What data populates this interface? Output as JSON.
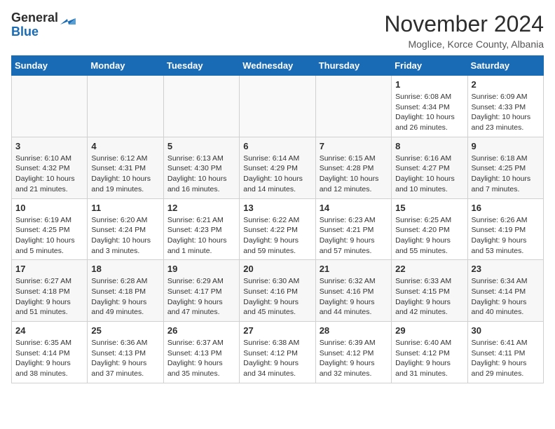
{
  "header": {
    "logo_line1": "General",
    "logo_line2": "Blue",
    "title": "November 2024",
    "subtitle": "Moglice, Korce County, Albania"
  },
  "columns": [
    "Sunday",
    "Monday",
    "Tuesday",
    "Wednesday",
    "Thursday",
    "Friday",
    "Saturday"
  ],
  "weeks": [
    [
      {
        "day": "",
        "info": ""
      },
      {
        "day": "",
        "info": ""
      },
      {
        "day": "",
        "info": ""
      },
      {
        "day": "",
        "info": ""
      },
      {
        "day": "",
        "info": ""
      },
      {
        "day": "1",
        "info": "Sunrise: 6:08 AM\nSunset: 4:34 PM\nDaylight: 10 hours and 26 minutes."
      },
      {
        "day": "2",
        "info": "Sunrise: 6:09 AM\nSunset: 4:33 PM\nDaylight: 10 hours and 23 minutes."
      }
    ],
    [
      {
        "day": "3",
        "info": "Sunrise: 6:10 AM\nSunset: 4:32 PM\nDaylight: 10 hours and 21 minutes."
      },
      {
        "day": "4",
        "info": "Sunrise: 6:12 AM\nSunset: 4:31 PM\nDaylight: 10 hours and 19 minutes."
      },
      {
        "day": "5",
        "info": "Sunrise: 6:13 AM\nSunset: 4:30 PM\nDaylight: 10 hours and 16 minutes."
      },
      {
        "day": "6",
        "info": "Sunrise: 6:14 AM\nSunset: 4:29 PM\nDaylight: 10 hours and 14 minutes."
      },
      {
        "day": "7",
        "info": "Sunrise: 6:15 AM\nSunset: 4:28 PM\nDaylight: 10 hours and 12 minutes."
      },
      {
        "day": "8",
        "info": "Sunrise: 6:16 AM\nSunset: 4:27 PM\nDaylight: 10 hours and 10 minutes."
      },
      {
        "day": "9",
        "info": "Sunrise: 6:18 AM\nSunset: 4:25 PM\nDaylight: 10 hours and 7 minutes."
      }
    ],
    [
      {
        "day": "10",
        "info": "Sunrise: 6:19 AM\nSunset: 4:25 PM\nDaylight: 10 hours and 5 minutes."
      },
      {
        "day": "11",
        "info": "Sunrise: 6:20 AM\nSunset: 4:24 PM\nDaylight: 10 hours and 3 minutes."
      },
      {
        "day": "12",
        "info": "Sunrise: 6:21 AM\nSunset: 4:23 PM\nDaylight: 10 hours and 1 minute."
      },
      {
        "day": "13",
        "info": "Sunrise: 6:22 AM\nSunset: 4:22 PM\nDaylight: 9 hours and 59 minutes."
      },
      {
        "day": "14",
        "info": "Sunrise: 6:23 AM\nSunset: 4:21 PM\nDaylight: 9 hours and 57 minutes."
      },
      {
        "day": "15",
        "info": "Sunrise: 6:25 AM\nSunset: 4:20 PM\nDaylight: 9 hours and 55 minutes."
      },
      {
        "day": "16",
        "info": "Sunrise: 6:26 AM\nSunset: 4:19 PM\nDaylight: 9 hours and 53 minutes."
      }
    ],
    [
      {
        "day": "17",
        "info": "Sunrise: 6:27 AM\nSunset: 4:18 PM\nDaylight: 9 hours and 51 minutes."
      },
      {
        "day": "18",
        "info": "Sunrise: 6:28 AM\nSunset: 4:18 PM\nDaylight: 9 hours and 49 minutes."
      },
      {
        "day": "19",
        "info": "Sunrise: 6:29 AM\nSunset: 4:17 PM\nDaylight: 9 hours and 47 minutes."
      },
      {
        "day": "20",
        "info": "Sunrise: 6:30 AM\nSunset: 4:16 PM\nDaylight: 9 hours and 45 minutes."
      },
      {
        "day": "21",
        "info": "Sunrise: 6:32 AM\nSunset: 4:16 PM\nDaylight: 9 hours and 44 minutes."
      },
      {
        "day": "22",
        "info": "Sunrise: 6:33 AM\nSunset: 4:15 PM\nDaylight: 9 hours and 42 minutes."
      },
      {
        "day": "23",
        "info": "Sunrise: 6:34 AM\nSunset: 4:14 PM\nDaylight: 9 hours and 40 minutes."
      }
    ],
    [
      {
        "day": "24",
        "info": "Sunrise: 6:35 AM\nSunset: 4:14 PM\nDaylight: 9 hours and 38 minutes."
      },
      {
        "day": "25",
        "info": "Sunrise: 6:36 AM\nSunset: 4:13 PM\nDaylight: 9 hours and 37 minutes."
      },
      {
        "day": "26",
        "info": "Sunrise: 6:37 AM\nSunset: 4:13 PM\nDaylight: 9 hours and 35 minutes."
      },
      {
        "day": "27",
        "info": "Sunrise: 6:38 AM\nSunset: 4:12 PM\nDaylight: 9 hours and 34 minutes."
      },
      {
        "day": "28",
        "info": "Sunrise: 6:39 AM\nSunset: 4:12 PM\nDaylight: 9 hours and 32 minutes."
      },
      {
        "day": "29",
        "info": "Sunrise: 6:40 AM\nSunset: 4:12 PM\nDaylight: 9 hours and 31 minutes."
      },
      {
        "day": "30",
        "info": "Sunrise: 6:41 AM\nSunset: 4:11 PM\nDaylight: 9 hours and 29 minutes."
      }
    ]
  ]
}
